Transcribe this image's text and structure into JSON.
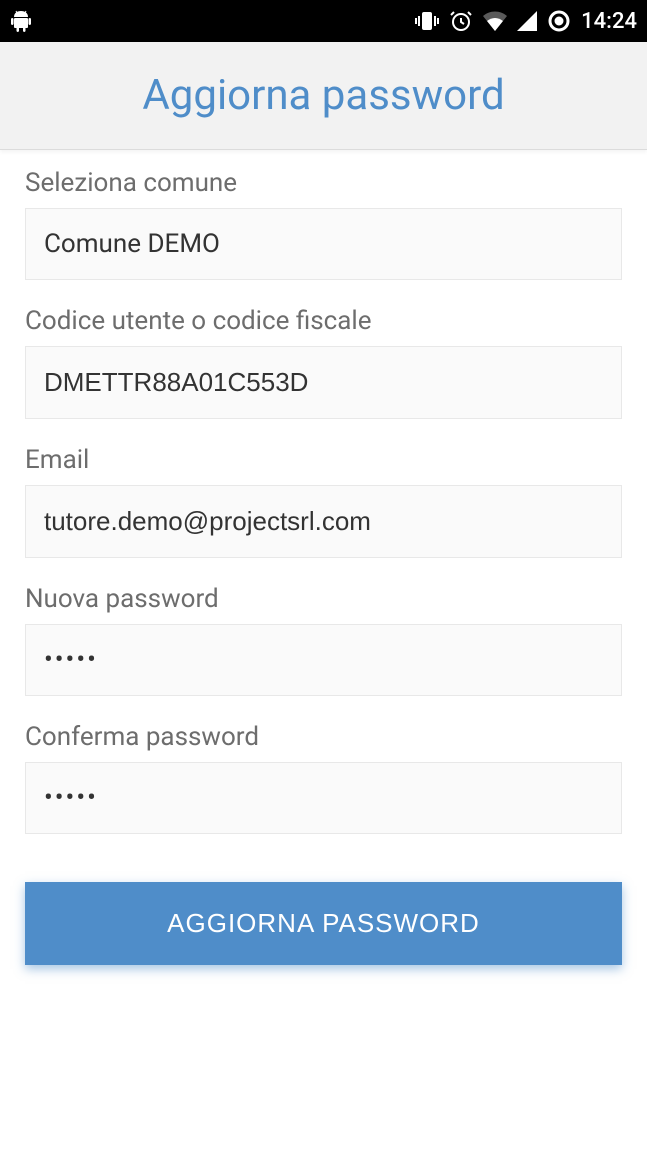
{
  "status_bar": {
    "time": "14:24"
  },
  "header": {
    "title": "Aggiorna password"
  },
  "form": {
    "comune": {
      "label": "Seleziona comune",
      "value": "Comune DEMO"
    },
    "codice": {
      "label": "Codice utente o codice fiscale",
      "value": "DMETTR88A01C553D"
    },
    "email": {
      "label": "Email",
      "value": "tutore.demo@projectsrl.com"
    },
    "nuova_password": {
      "label": "Nuova password",
      "value": "•••••"
    },
    "conferma_password": {
      "label": "Conferma password",
      "value": "•••••"
    },
    "submit_label": "AGGIORNA PASSWORD"
  }
}
